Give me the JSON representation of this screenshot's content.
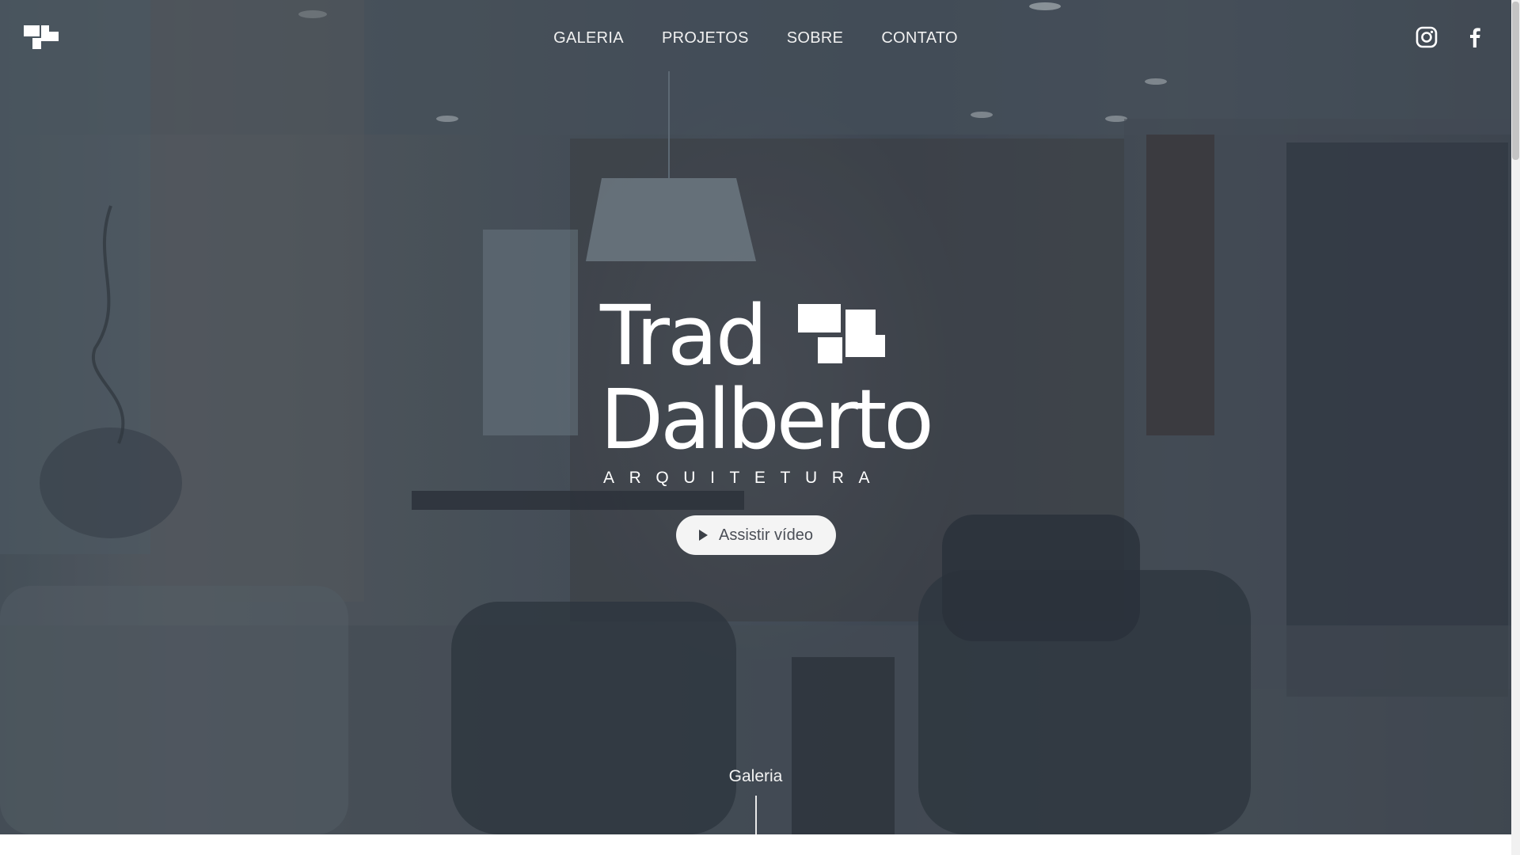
{
  "nav": {
    "items": [
      {
        "label": "GALERIA"
      },
      {
        "label": "PROJETOS"
      },
      {
        "label": "SOBRE"
      },
      {
        "label": "CONTATO"
      }
    ]
  },
  "social": {
    "instagram": "instagram-icon",
    "facebook": "facebook-icon"
  },
  "logo": {
    "line1": "Trad",
    "line2": "Dalberto",
    "subtitle": "ARQUITETURA"
  },
  "hero": {
    "cta_label": "Assistir vídeo",
    "scroll_label": "Galeria"
  },
  "colors": {
    "text": "#ffffff",
    "button_bg": "#f4f4f4",
    "button_text": "#4b4f57"
  }
}
